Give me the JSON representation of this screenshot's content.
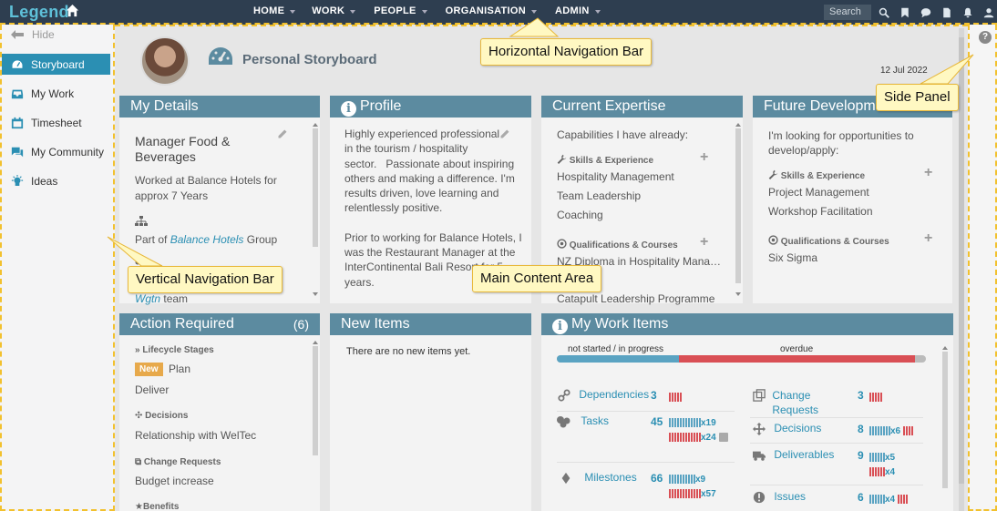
{
  "app": {
    "logo": "Legend"
  },
  "topnav": {
    "items": [
      "HOME",
      "WORK",
      "PEOPLE",
      "ORGANISATION",
      "ADMIN"
    ],
    "search_placeholder": "Search"
  },
  "sidebar": {
    "hide_label": "Hide",
    "items": [
      {
        "label": "Storyboard",
        "icon": "dashboard-icon",
        "active": true
      },
      {
        "label": "My Work",
        "icon": "inbox-icon"
      },
      {
        "label": "Timesheet",
        "icon": "calendar-icon"
      },
      {
        "label": "My Community",
        "icon": "chat-icon"
      },
      {
        "label": "Ideas",
        "icon": "lightbulb-icon"
      }
    ]
  },
  "storyboard": {
    "title": "Personal Storyboard",
    "date": "12 Jul 2022"
  },
  "my_details": {
    "title": "My Details",
    "role": "Manager Food & Beverages",
    "tenure": "Worked at Balance Hotels for approx 7 Years",
    "part_of_prefix": "Part of",
    "part_of_link": "Balance Hotels",
    "part_of_suffix": "Group",
    "team_link": "Wgtn",
    "team_suffix": "team"
  },
  "profile": {
    "title": "Profile",
    "lines": [
      "Highly experienced professional",
      "in the tourism / hospitality",
      "sector.   Passionate about inspiring",
      "others and making a difference. I'm",
      "results driven, love learning and",
      "relentlessly positive.",
      "",
      "Prior to working for Balance Hotels, I",
      "was the Restaurant Manager at the",
      "InterContinental Bali Resort for 5",
      "years."
    ]
  },
  "current_expertise": {
    "title": "Current Expertise",
    "intro": "Capabilities I have already:",
    "skills_heading": "Skills & Experience",
    "skills": [
      "Hospitality Management",
      "Team Leadership",
      "Coaching"
    ],
    "quals_heading": "Qualifications & Courses",
    "quals": [
      "NZ Diploma in Hospitality Mana…",
      "Catapult Leadership Programme"
    ]
  },
  "future_development": {
    "title": "Future Development",
    "intro_line1": "I'm looking for opportunities to",
    "intro_line2": "develop/apply:",
    "skills_heading": "Skills & Experience",
    "skills": [
      "Project Management",
      "Workshop Facilitation"
    ],
    "quals_heading": "Qualifications & Courses",
    "quals": [
      "Six Sigma"
    ]
  },
  "action_required": {
    "title": "Action Required",
    "count": "(6)",
    "lifecycle_heading": "Lifecycle Stages",
    "badge_new": "New",
    "plan": "Plan",
    "deliver": "Deliver",
    "decisions_heading": "Decisions",
    "decision_item": "Relationship with WelTec",
    "cr_heading": "Change Requests",
    "cr_item": "Budget increase",
    "benefits_heading": "Benefits"
  },
  "new_items": {
    "title": "New Items",
    "empty": "There are no new items yet."
  },
  "my_work_items": {
    "title": "My Work Items",
    "legend_left": "not started / in progress",
    "legend_right": "overdue",
    "progress": {
      "not_started_in_progress_fraction": 0.33,
      "overdue_fraction": 0.64
    },
    "colors": {
      "blue": "#5aa3c2",
      "red": "#d94f55",
      "grey": "#aaaaaa"
    },
    "left": [
      {
        "label": "Dependencies",
        "count": "3",
        "icon": "link-icon"
      },
      {
        "label": "Tasks",
        "count": "45",
        "icon": "tasks-icon",
        "blue_x": "x19",
        "red_x": "x24"
      },
      {
        "label": "Milestones",
        "count": "66",
        "icon": "milestone-icon",
        "blue_x": "x9",
        "red_x": "x57"
      }
    ],
    "right": [
      {
        "label_line1": "Change",
        "label_line2": "Requests",
        "count": "3",
        "icon": "change-icon"
      },
      {
        "label": "Decisions",
        "count": "8",
        "icon": "decision-icon",
        "blue_x": "x6"
      },
      {
        "label": "Deliverables",
        "count": "9",
        "icon": "truck-icon",
        "blue_x": "x5",
        "red_x": "x4"
      },
      {
        "label": "Issues",
        "count": "6",
        "icon": "issue-icon",
        "blue_x": "x4"
      }
    ]
  },
  "callouts": {
    "horizontal": "Horizontal Navigation Bar",
    "vertical": "Vertical Navigation Bar",
    "main": "Main Content Area",
    "side": "Side Panel"
  }
}
